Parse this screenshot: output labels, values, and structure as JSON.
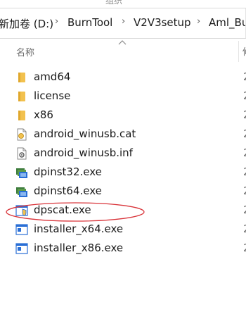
{
  "top_strip": {
    "fragment": "组织"
  },
  "address_bar": {
    "crumbs": [
      "新加卷 (D:)",
      "BurnTool",
      "V2V3setup",
      "Aml_Bu"
    ],
    "separator": "›"
  },
  "header": {
    "name_label": "名称",
    "next_column_fragment": "修"
  },
  "files": [
    {
      "name": "amd64",
      "icon": "folder-icon",
      "date_fragment": "2"
    },
    {
      "name": "license",
      "icon": "folder-icon",
      "date_fragment": "2"
    },
    {
      "name": "x86",
      "icon": "folder-icon",
      "date_fragment": "2"
    },
    {
      "name": "android_winusb.cat",
      "icon": "security-catalog-icon",
      "date_fragment": "2"
    },
    {
      "name": "android_winusb.inf",
      "icon": "setup-information-icon",
      "date_fragment": "2"
    },
    {
      "name": "dpinst32.exe",
      "icon": "installer-app-icon",
      "date_fragment": "2"
    },
    {
      "name": "dpinst64.exe",
      "icon": "installer-app-icon",
      "date_fragment": "2"
    },
    {
      "name": "dpscat.exe",
      "icon": "shield-app-icon",
      "date_fragment": "2"
    },
    {
      "name": "installer_x64.exe",
      "icon": "application-window-icon",
      "date_fragment": "2"
    },
    {
      "name": "installer_x86.exe",
      "icon": "application-window-icon",
      "date_fragment": "2"
    }
  ],
  "colors": {
    "annotation_red": "#d9343a",
    "folder_yellow": "#f2c14e",
    "accent_blue": "#2a6fd6"
  }
}
